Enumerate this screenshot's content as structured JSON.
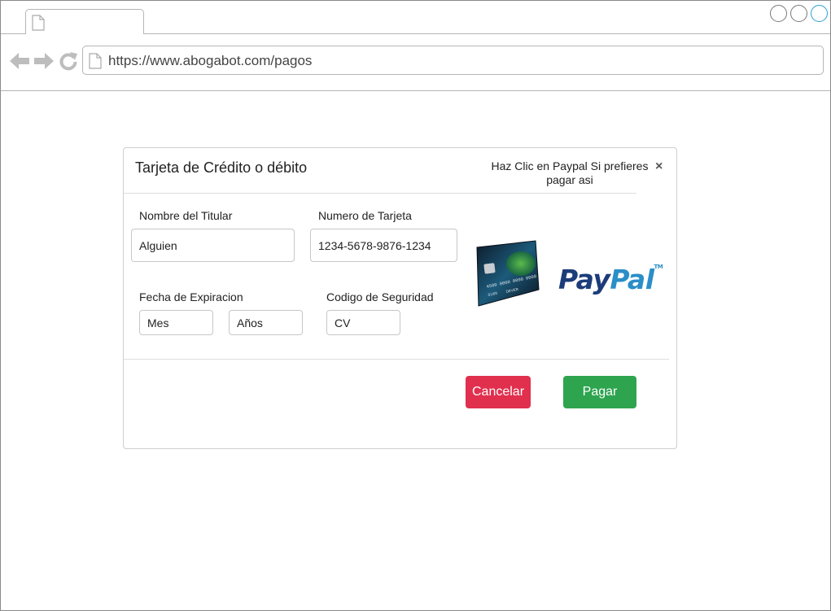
{
  "browser": {
    "url": "https://www.abogabot.com/pagos"
  },
  "modal": {
    "title": "Tarjeta de Crédito o débito",
    "paypal_hint": "Haz Clic en Paypal Si prefieres pagar asi",
    "close_label": "×",
    "holder": {
      "label": "Nombre del Titular",
      "value": "Alguien"
    },
    "card_number": {
      "label": "Numero de Tarjeta",
      "value": "1234-5678-9876-1234"
    },
    "expiration": {
      "label": "Fecha de Expiracion",
      "month_placeholder": "Mes",
      "year_placeholder": "Años"
    },
    "security": {
      "label": "Codigo de Seguridad",
      "placeholder": "CV"
    },
    "card_image": {
      "number": "4500 0000 0000 0000",
      "date": "01/09",
      "name": "DEVER"
    },
    "paypal": {
      "pay": "Pay",
      "pal": "Pal",
      "tm": "TM"
    },
    "cancel_label": "Cancelar",
    "pay_label": "Pagar"
  },
  "colors": {
    "cancel": "#e0304e",
    "pay": "#2ea44f",
    "paypal_dark": "#1c3c7a",
    "paypal_light": "#2a8ec8"
  }
}
